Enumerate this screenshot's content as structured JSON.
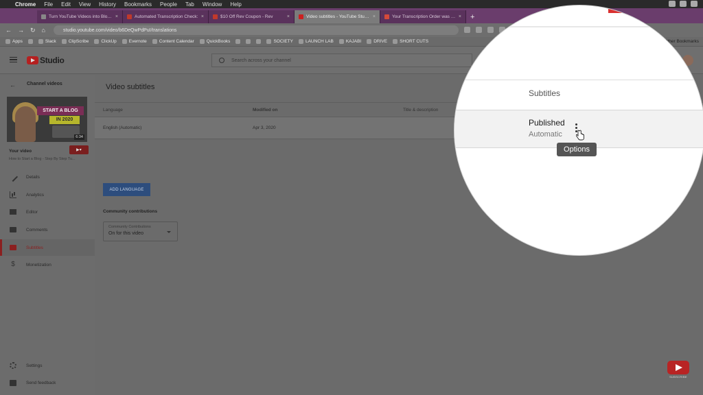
{
  "menubar": {
    "items": [
      "Chrome",
      "File",
      "Edit",
      "View",
      "History",
      "Bookmarks",
      "People",
      "Tab",
      "Window",
      "Help"
    ]
  },
  "tabs": [
    {
      "title": "Turn YouTube Videos into Blog P",
      "color": "#888888",
      "active": false
    },
    {
      "title": "Automated Transcription Check:",
      "color": "#c0392b",
      "active": false
    },
    {
      "title": "$10 Off Rev Coupon - Rev",
      "color": "#c0392b",
      "active": false
    },
    {
      "title": "Video subtitles - YouTube Studio",
      "color": "#cc2020",
      "active": true
    },
    {
      "title": "Your Transcription Order was Re",
      "color": "#d44a3a",
      "active": false
    }
  ],
  "address": {
    "url": "studio.youtube.com/video/b6DeQwPdPuI/translations"
  },
  "bookmarks": {
    "items": [
      "Apps",
      "",
      "Slack",
      "ClipScribe",
      "ClickUp",
      "Evernote",
      "Content Calendar",
      "QuickBooks",
      "",
      "",
      "",
      "SOCIETY",
      "LAUNCH LAB",
      "KAJABI",
      "DRIVE",
      "SHORT CUTS"
    ],
    "other": "Other Bookmarks"
  },
  "header": {
    "logo": "Studio",
    "search_placeholder": "Search across your channel"
  },
  "sidebar": {
    "back_label": "Channel videos",
    "thumb": {
      "title1": "START A BLOG",
      "title2": "IN 2020",
      "duration": "6:34"
    },
    "your_video": "Your video",
    "video_title": "How to Start a Blog - Step By Step Tu...",
    "nav": [
      {
        "label": "Details",
        "icon": "pencil-icon"
      },
      {
        "label": "Analytics",
        "icon": "analytics-icon"
      },
      {
        "label": "Editor",
        "icon": "editor-icon"
      },
      {
        "label": "Comments",
        "icon": "comments-icon"
      },
      {
        "label": "Subtitles",
        "icon": "subtitles-icon",
        "active": true
      },
      {
        "label": "Monetization",
        "icon": "dollar-icon"
      }
    ],
    "bottom": [
      {
        "label": "Settings",
        "icon": "gear-icon"
      },
      {
        "label": "Send feedback",
        "icon": "feedback-icon"
      }
    ]
  },
  "main": {
    "title": "Video subtitles",
    "columns": [
      "Language",
      "Modified on",
      "Title & description"
    ],
    "rows": [
      {
        "language": "English (Automatic)",
        "modified": "Apr 3, 2020"
      }
    ],
    "add_language": "ADD LANGUAGE",
    "community_title": "Community contributions",
    "community_select": {
      "label": "Community Contributions",
      "value": "On for this video"
    }
  },
  "zoom": {
    "column": "Subtitles",
    "status": "Published",
    "substatus": "Automatic",
    "tooltip": "Options"
  },
  "subscribe": "SUBSCRIBE"
}
